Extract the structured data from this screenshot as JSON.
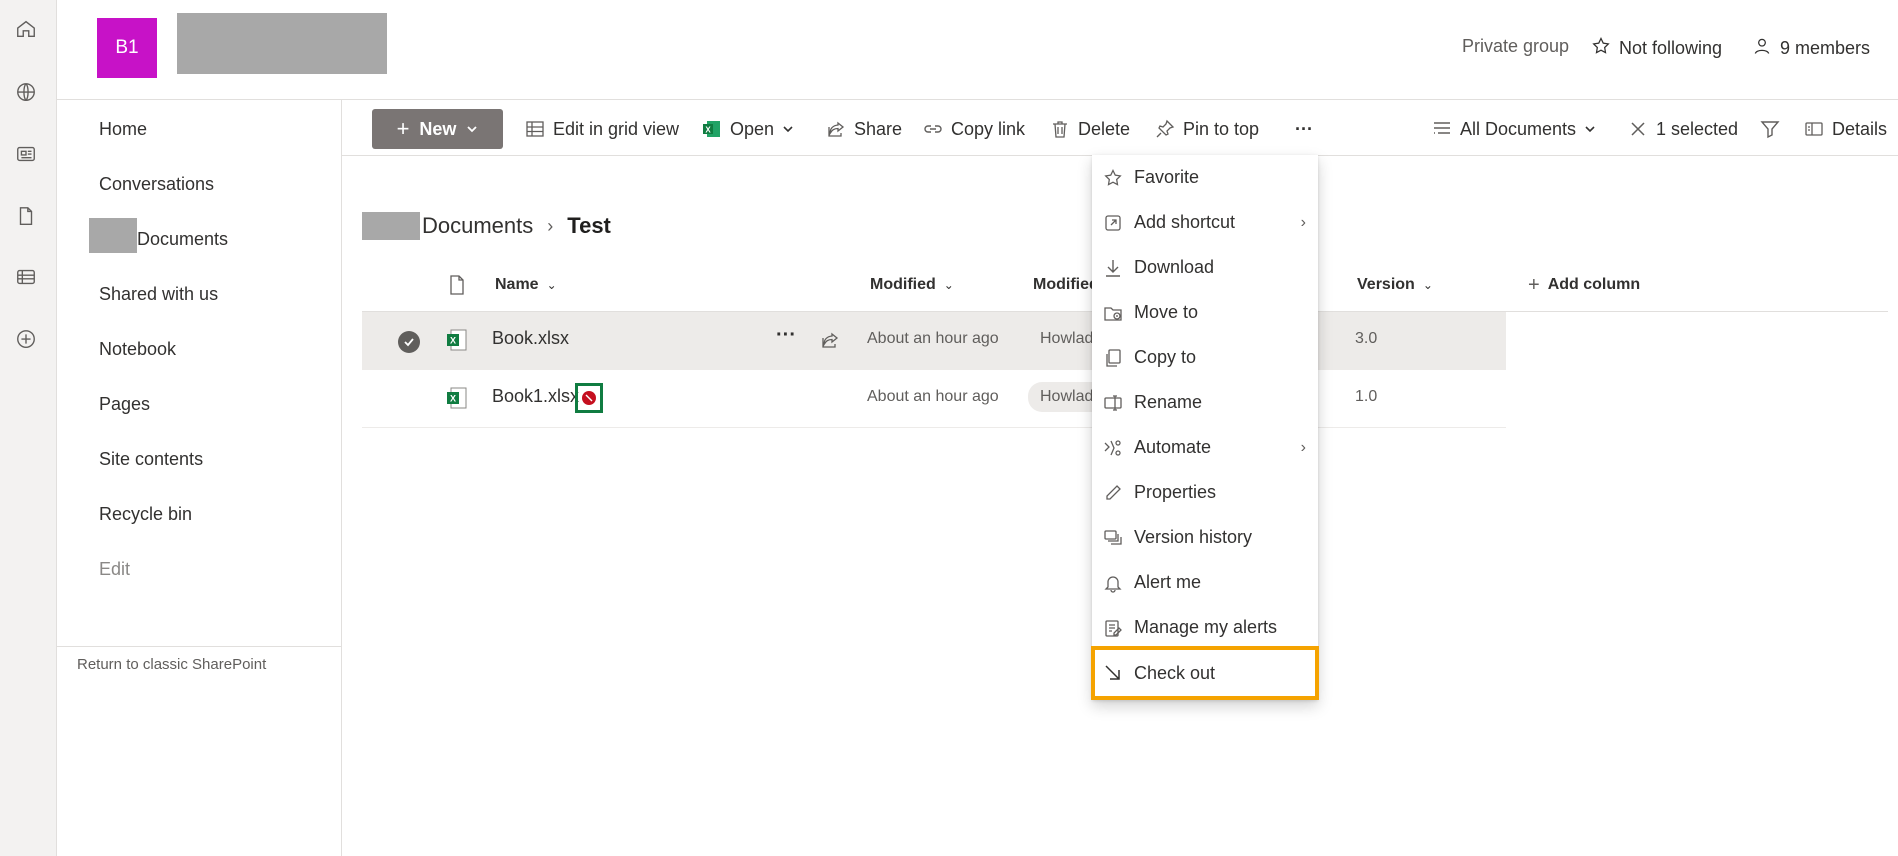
{
  "site": {
    "logo_text": "B1",
    "privacy": "Private group",
    "following": "Not following",
    "members": "9 members"
  },
  "rail": {
    "icons": [
      "home-icon",
      "globe-icon",
      "news-icon",
      "file-icon",
      "list-icon",
      "add-circle-icon"
    ]
  },
  "leftnav": {
    "items": [
      "Home",
      "Conversations",
      "Documents",
      "Shared with us",
      "Notebook",
      "Pages",
      "Site contents",
      "Recycle bin",
      "Edit"
    ],
    "classic": "Return to classic SharePoint"
  },
  "cmdbar": {
    "new": "New",
    "edit_grid": "Edit in grid view",
    "open": "Open",
    "share": "Share",
    "copy_link": "Copy link",
    "delete": "Delete",
    "pin": "Pin to top",
    "more": "···",
    "view": "All Documents",
    "selected": "1 selected",
    "details": "Details"
  },
  "breadcrumb": {
    "parent": "Documents",
    "separator": "›",
    "current": "Test"
  },
  "columns": {
    "name": "Name",
    "modified": "Modified",
    "modified_by": "Modified",
    "version": "Version",
    "add": "Add column"
  },
  "rows": [
    {
      "name": "Book.xlsx",
      "modified": "About an hour ago",
      "modified_by": "Howlade",
      "version": "3.0"
    },
    {
      "name": "Book1.xlsx",
      "modified": "About an hour ago",
      "modified_by": "Howlade",
      "version": "1.0"
    }
  ],
  "menu": {
    "items": [
      "Favorite",
      "Add shortcut",
      "Download",
      "Move to",
      "Copy to",
      "Rename",
      "Automate",
      "Properties",
      "Version history",
      "Alert me",
      "Manage my alerts",
      "Check out"
    ],
    "highlighted": "Check out",
    "highlight_color": "#f5a300"
  },
  "colors": {
    "accent_logo": "#c712c7",
    "new_button": "#7a7574",
    "excel_green": "#107c41",
    "checkout_badge": "#c50f1f"
  }
}
